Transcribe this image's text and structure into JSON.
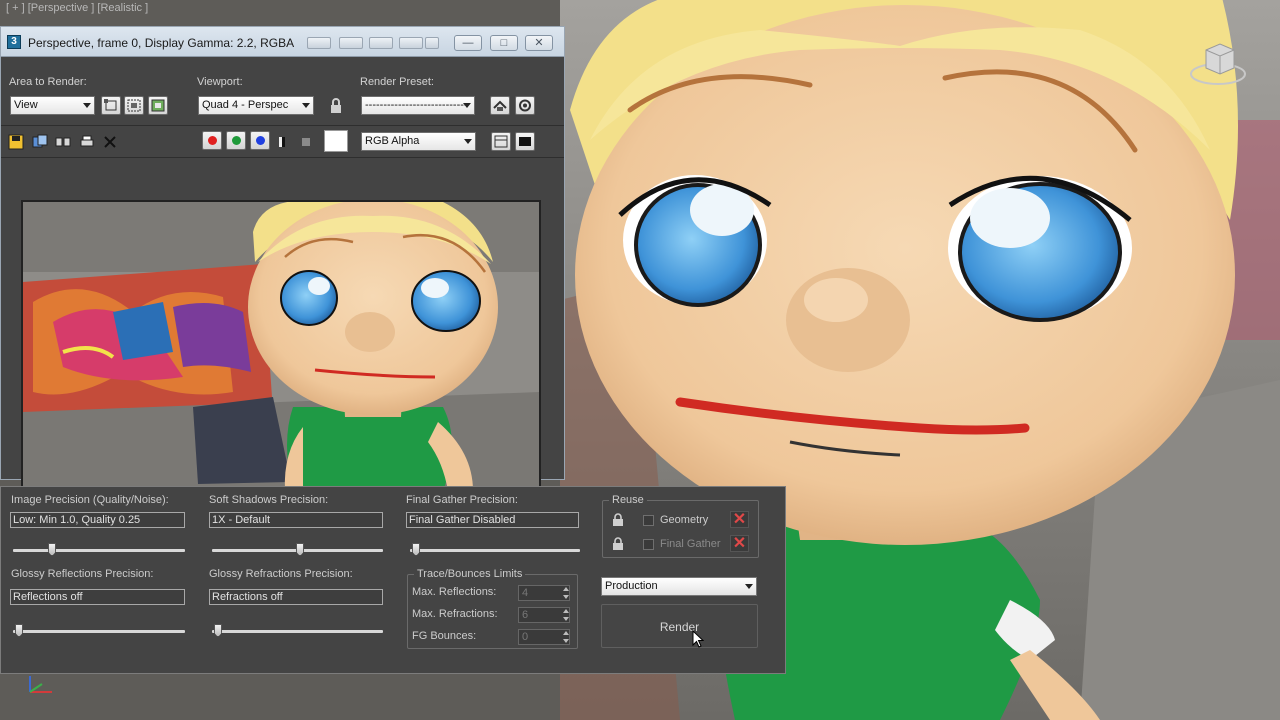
{
  "viewport": {
    "label": "[ + ] [Perspective ] [Realistic ]"
  },
  "frame_window": {
    "title": "Perspective, frame 0, Display Gamma: 2.2, RGBA",
    "area_to_render": {
      "label": "Area to Render:",
      "value": "View"
    },
    "viewport_select": {
      "label": "Viewport:",
      "value": "Quad 4 - Perspec"
    },
    "render_preset": {
      "label": "Render Preset:",
      "value": "----------------------------"
    },
    "channel_display": {
      "value": "RGB Alpha"
    }
  },
  "settings": {
    "image_precision": {
      "label": "Image Precision (Quality/Noise):",
      "value": "Low: Min 1.0, Quality 0.25",
      "slider": 0.2
    },
    "soft_shadows": {
      "label": "Soft Shadows Precision:",
      "value": "1X - Default",
      "slider": 0.5
    },
    "final_gather": {
      "label": "Final Gather Precision:",
      "value": "Final Gather Disabled",
      "slider": 0.0
    },
    "glossy_reflections": {
      "label": "Glossy Reflections Precision:",
      "value": "Reflections off",
      "slider": 0.0
    },
    "glossy_refractions": {
      "label": "Glossy Refractions Precision:",
      "value": "Refractions off",
      "slider": 0.0
    },
    "trace_bounces": {
      "title": "Trace/Bounces Limits",
      "max_reflections": {
        "label": "Max. Reflections:",
        "value": "4"
      },
      "max_refractions": {
        "label": "Max. Refractions:",
        "value": "6"
      },
      "fg_bounces": {
        "label": "FG Bounces:",
        "value": "0"
      }
    },
    "reuse": {
      "title": "Reuse",
      "geometry": {
        "label": "Geometry",
        "checked": false
      },
      "final_gather": {
        "label": "Final Gather",
        "checked": false
      }
    },
    "render_mode": {
      "value": "Production"
    },
    "render_button": {
      "label": "Render"
    }
  },
  "colors": {
    "panel_bg": "#444444",
    "titlebar": "#cfdae6",
    "skin": "#f2cfa4",
    "hair": "#f3e08a",
    "shirt": "#1f9a45",
    "eye": "#3f9ae0",
    "lip": "#d02a22"
  }
}
